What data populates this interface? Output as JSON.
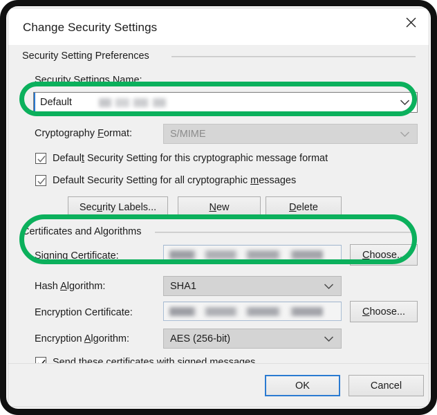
{
  "window": {
    "title": "Change Security Settings",
    "close_icon": "close-icon"
  },
  "groups": {
    "preferences": "Security Setting Preferences",
    "certificates": "Certificates and Algorithms"
  },
  "fields": {
    "settings_name": {
      "label": "Security Settings Name:",
      "value": "Default",
      "redacted_suffix": true,
      "chevron_icon": "chevron-down-icon"
    },
    "crypto_format": {
      "label": "Cryptography Format:",
      "value": "S/MIME",
      "disabled": true,
      "chevron_icon": "chevron-down-icon"
    },
    "signing_certificate": {
      "label": "Signing Certificate:",
      "value": "",
      "redacted": true,
      "button": "Choose..."
    },
    "hash_algorithm": {
      "label": "Hash Algorithm:",
      "value": "SHA1",
      "chevron_icon": "chevron-down-icon"
    },
    "encryption_certificate": {
      "label": "Encryption Certificate:",
      "value": "",
      "redacted": true,
      "button": "Choose..."
    },
    "encryption_algorithm": {
      "label": "Encryption Algorithm:",
      "value": "AES (256-bit)",
      "chevron_icon": "chevron-down-icon"
    }
  },
  "checkboxes": {
    "default_this_format": {
      "label": "Default Security Setting for this cryptographic message format",
      "checked": true,
      "state": "disabled"
    },
    "default_all_messages": {
      "label": "Default Security Setting for all cryptographic messages",
      "checked": true,
      "state": "disabled"
    },
    "send_certificates": {
      "label": "Send these certificates with signed messages",
      "checked": true,
      "state": "enabled"
    }
  },
  "buttons": {
    "security_labels": "Security Labels...",
    "new": "New",
    "delete": "Delete",
    "choose_signing": "Choose...",
    "choose_encryption": "Choose...",
    "ok": "OK",
    "cancel": "Cancel"
  },
  "annotations": {
    "highlight_color": "#0bb05c",
    "rings": [
      {
        "name": "settings-name-highlight",
        "target": "settings_name"
      },
      {
        "name": "certificates-section-highlight",
        "target": "signing_certificate"
      }
    ]
  },
  "colors": {
    "frame": "#101010",
    "dialog_bg": "#f0f0f0",
    "titlebar_bg": "#ffffff",
    "accent_focus": "#2a7ad1",
    "highlight_green": "#0bb05c",
    "text": "#1b1b1b",
    "disabled_text": "#8b8b8b"
  }
}
